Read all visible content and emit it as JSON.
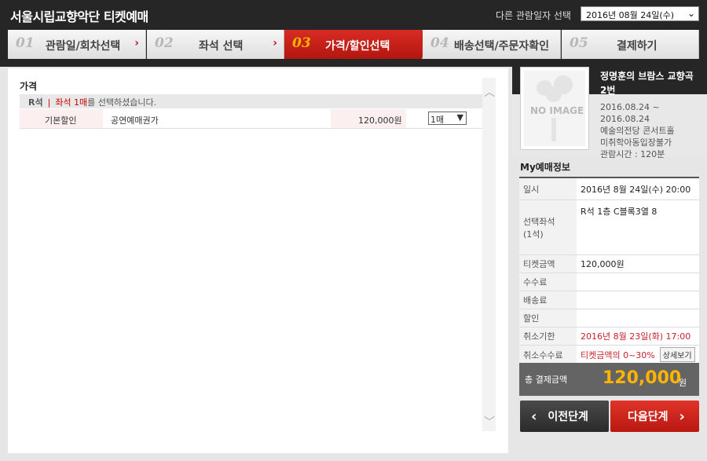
{
  "header": {
    "title": "서울시립교향악단 티켓예매",
    "date_label": "다른 관람일자 선택",
    "date_value": "2016년 08월 24일(수)"
  },
  "steps": [
    {
      "num": "01",
      "label": "관람일/회차선택"
    },
    {
      "num": "02",
      "label": "좌석 선택"
    },
    {
      "num": "03",
      "label": "가격/할인선택"
    },
    {
      "num": "04",
      "label": "배송선택/주문자확인"
    },
    {
      "num": "05",
      "label": "결제하기"
    }
  ],
  "price": {
    "title": "가격",
    "seat_grade": "R석",
    "seat_msg_red": "좌석 1매",
    "seat_msg": "를 선택하셨습니다.",
    "row": {
      "type": "기본할인",
      "name": "공연예매권가",
      "amount": "120,000원",
      "qty": "1매"
    }
  },
  "show": {
    "noimage": "NO IMAGE",
    "title": "정명훈의 브람스 교향곡 2번",
    "period": "2016.08.24 ~ 2016.08.24",
    "venue": "예술의전당 콘서트홀",
    "age": "미취학아동입장불가",
    "runtime": "관람시간 : 120분"
  },
  "my_booking": {
    "title": "My예매정보",
    "rows": [
      {
        "k": "일시",
        "v": "2016년 8월 24일(수) 20:00"
      },
      {
        "k": "선택좌석\n(1석)",
        "v": "R석 1층 C블록3열 8"
      },
      {
        "k": "티켓금액",
        "v": "120,000원"
      },
      {
        "k": "수수료",
        "v": ""
      },
      {
        "k": "배송료",
        "v": ""
      },
      {
        "k": "할인",
        "v": ""
      },
      {
        "k": "취소기한",
        "v": "2016년 8월 23일(화) 17:00"
      },
      {
        "k": "취소수수료",
        "v": "티켓금액의 0~30%",
        "btn": "상세보기"
      }
    ],
    "total_label": "총 결제금액",
    "total_value": "120,000",
    "total_unit": "원"
  },
  "buttons": {
    "prev": "이전단계",
    "next": "다음단계"
  }
}
